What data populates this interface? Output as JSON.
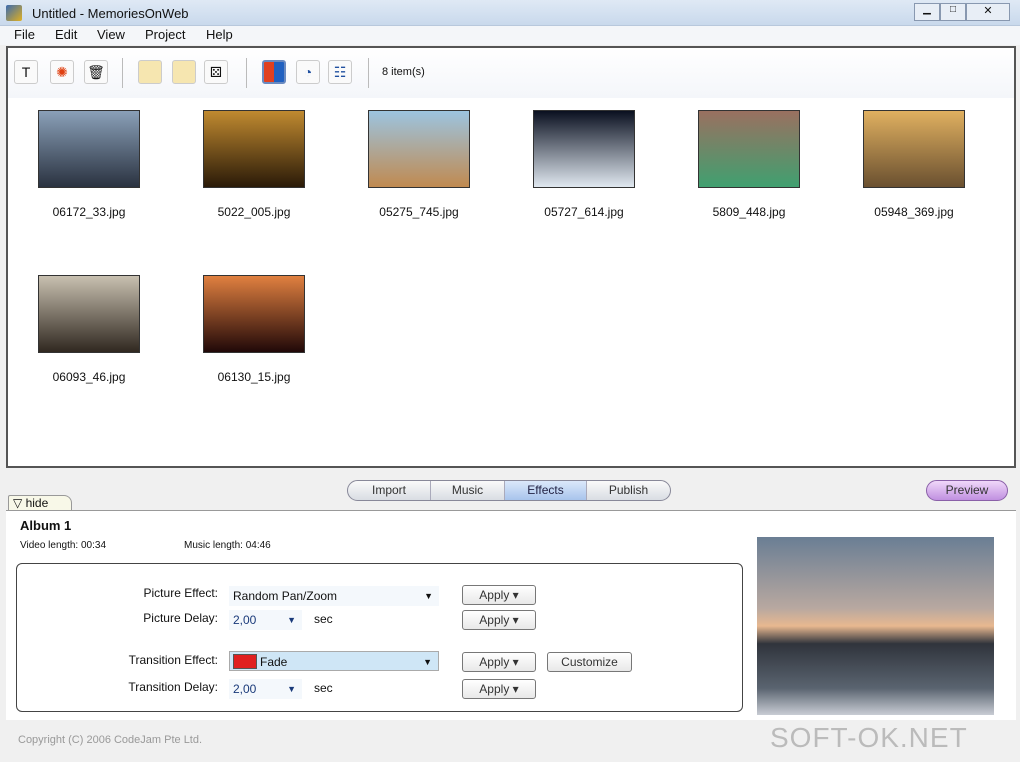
{
  "window": {
    "title": "Untitled - MemoriesOnWeb"
  },
  "menu": [
    "File",
    "Edit",
    "View",
    "Project",
    "Help"
  ],
  "toolbar": {
    "item_count": "8 item(s)"
  },
  "thumbnails": [
    {
      "name": "06172_33.jpg",
      "colors": [
        "#8aa0b8",
        "#2a3240"
      ]
    },
    {
      "name": "5022_005.jpg",
      "colors": [
        "#c08a30",
        "#2a1a08"
      ]
    },
    {
      "name": "05275_745.jpg",
      "colors": [
        "#9cc4e0",
        "#c08a50"
      ]
    },
    {
      "name": "05727_614.jpg",
      "colors": [
        "#0a1020",
        "#e0e8f0"
      ]
    },
    {
      "name": "5809_448.jpg",
      "colors": [
        "#9a7060",
        "#40a070"
      ]
    },
    {
      "name": "05948_369.jpg",
      "colors": [
        "#e0b060",
        "#6a5030"
      ]
    },
    {
      "name": "06093_46.jpg",
      "colors": [
        "#c8c0b0",
        "#302820"
      ]
    },
    {
      "name": "06130_15.jpg",
      "colors": [
        "#e08040",
        "#200808"
      ]
    }
  ],
  "tabs": {
    "items": [
      "Import",
      "Music",
      "Effects",
      "Publish"
    ],
    "active": "Effects",
    "preview": "Preview",
    "hide": "▽ hide"
  },
  "album": {
    "title": "Album 1",
    "video_length": "Video length: 00:34",
    "music_length": "Music length: 04:46"
  },
  "effects": {
    "picture_effect_label": "Picture Effect:",
    "picture_effect": "Random Pan/Zoom",
    "picture_delay_label": "Picture Delay:",
    "picture_delay": "2,00",
    "transition_effect_label": "Transition Effect:",
    "transition_effect": "Fade",
    "transition_delay_label": "Transition Delay:",
    "transition_delay": "2,00",
    "sec": "sec",
    "apply": "Apply",
    "customize": "Customize"
  },
  "footer": {
    "copyright": "Copyright (C) 2006 CodeJam Pte Ltd."
  },
  "watermark": "SOFT-OK.NET"
}
